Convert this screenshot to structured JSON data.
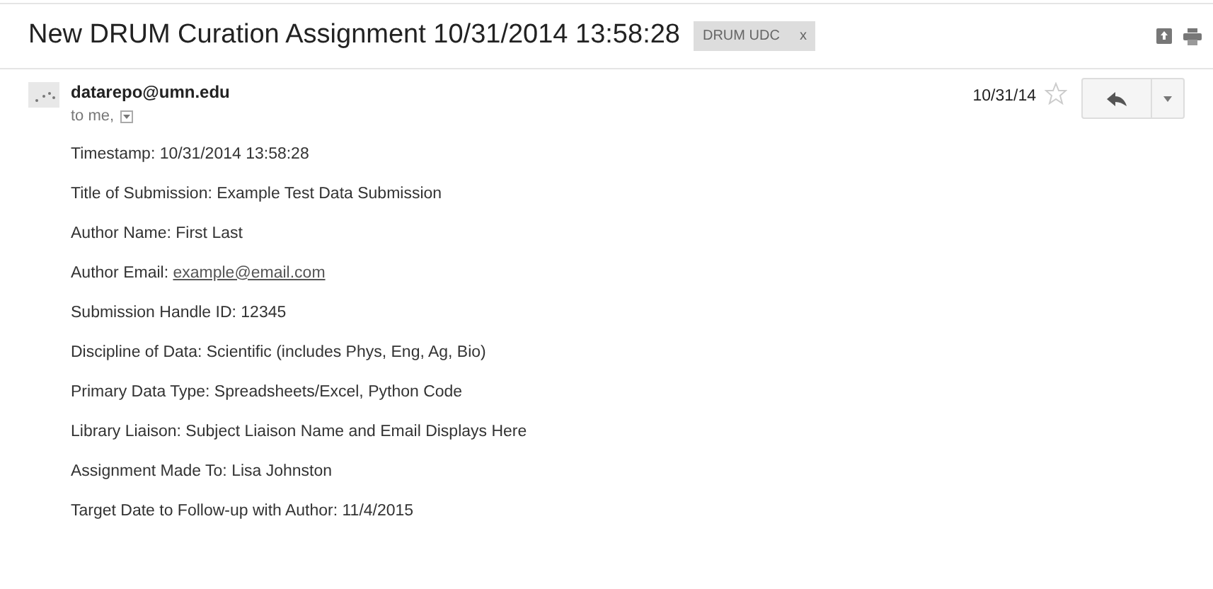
{
  "subject": "New DRUM Curation Assignment 10/31/2014 13:58:28",
  "label": {
    "text": "DRUM UDC",
    "remove": "x"
  },
  "sender": "datarepo@umn.edu",
  "recipients": "to me,",
  "date": "10/31/14",
  "starred": false,
  "body": [
    {
      "kind": "text",
      "text": "Timestamp: 10/31/2014 13:58:28"
    },
    {
      "kind": "text",
      "text": "Title of Submission: Example Test Data Submission"
    },
    {
      "kind": "text",
      "text": "Author Name: First Last"
    },
    {
      "kind": "link",
      "text": "Author Email: ",
      "link": "example@email.com"
    },
    {
      "kind": "text",
      "text": "Submission Handle ID: 12345"
    },
    {
      "kind": "text",
      "text": "Discipline of Data: Scientific (includes Phys, Eng, Ag, Bio)"
    },
    {
      "kind": "text",
      "text": "Primary Data Type: Spreadsheets/Excel, Python Code"
    },
    {
      "kind": "text",
      "text": "Library Liaison: Subject Liaison Name and Email Displays Here"
    },
    {
      "kind": "text",
      "text": "Assignment Made To: Lisa Johnston"
    },
    {
      "kind": "text",
      "text": "Target Date to Follow-up with Author: 11/4/2015"
    }
  ]
}
